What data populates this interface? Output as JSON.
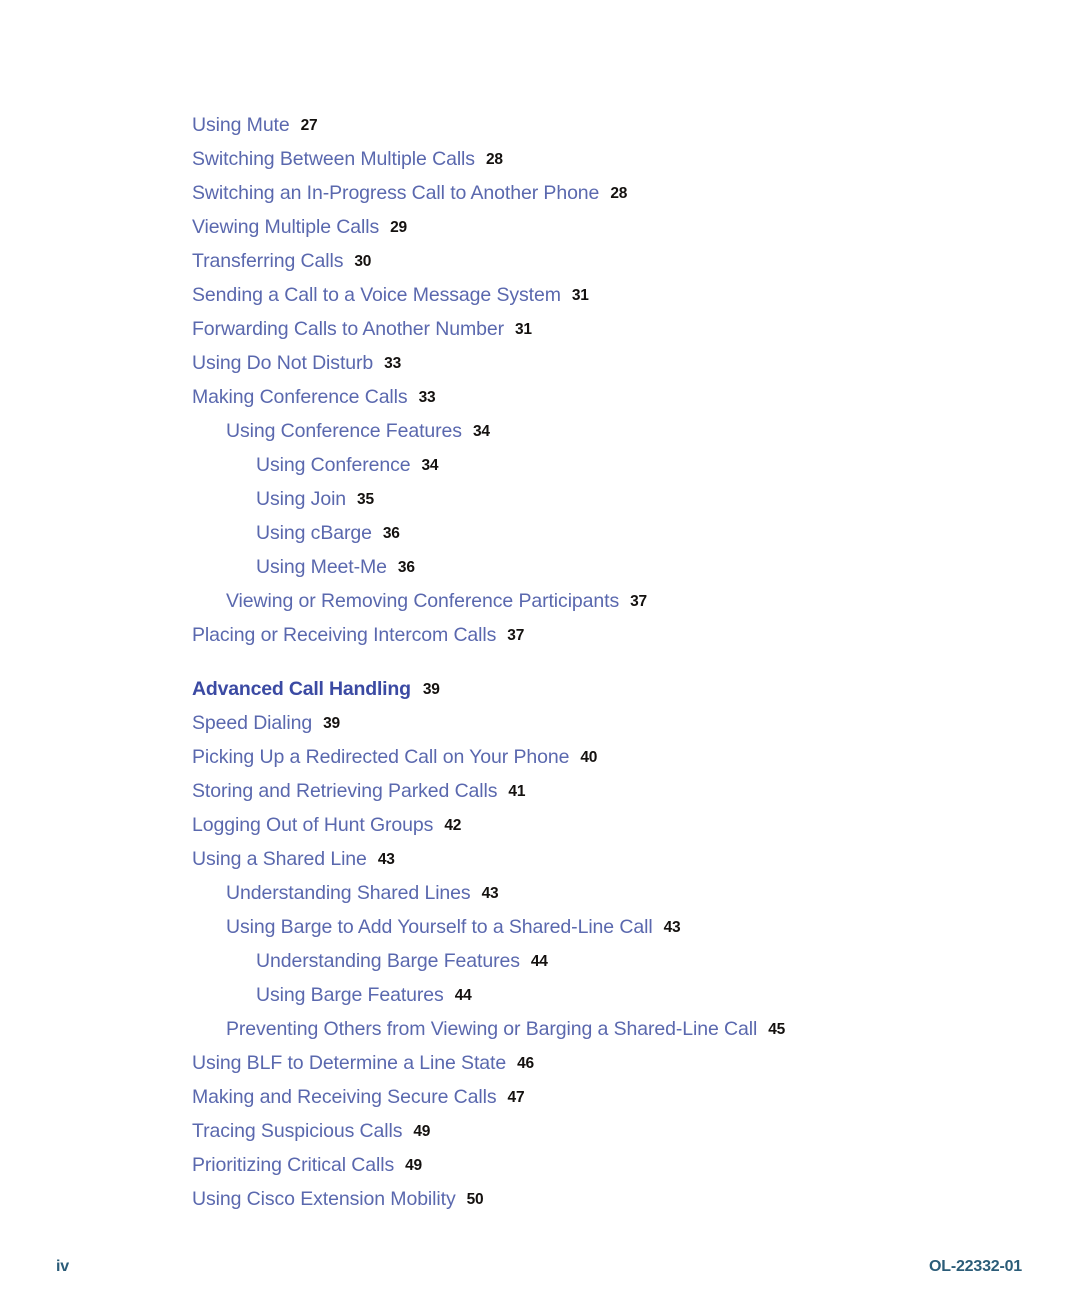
{
  "document": {
    "page_label": "iv",
    "doc_id": "OL-22332-01"
  },
  "colors": {
    "entry_text": "#5a68ae",
    "heading_text": "#3b4aa3",
    "page_number": "#14110f",
    "footer_text": "#2b5c78",
    "background": "#ffffff"
  },
  "toc": {
    "entries": [
      {
        "level": 1,
        "title": "Using Mute",
        "page": "27",
        "heading": false
      },
      {
        "level": 1,
        "title": "Switching Between Multiple Calls",
        "page": "28",
        "heading": false
      },
      {
        "level": 1,
        "title": "Switching an In-Progress Call to Another Phone",
        "page": "28",
        "heading": false
      },
      {
        "level": 1,
        "title": "Viewing Multiple Calls",
        "page": "29",
        "heading": false
      },
      {
        "level": 1,
        "title": "Transferring Calls",
        "page": "30",
        "heading": false
      },
      {
        "level": 1,
        "title": "Sending a Call to a Voice Message System",
        "page": "31",
        "heading": false
      },
      {
        "level": 1,
        "title": "Forwarding Calls to Another Number",
        "page": "31",
        "heading": false
      },
      {
        "level": 1,
        "title": "Using Do Not Disturb",
        "page": "33",
        "heading": false
      },
      {
        "level": 1,
        "title": "Making Conference Calls",
        "page": "33",
        "heading": false
      },
      {
        "level": 2,
        "title": "Using Conference Features",
        "page": "34",
        "heading": false
      },
      {
        "level": 3,
        "title": "Using Conference",
        "page": "34",
        "heading": false
      },
      {
        "level": 3,
        "title": "Using Join",
        "page": "35",
        "heading": false
      },
      {
        "level": 3,
        "title": "Using cBarge",
        "page": "36",
        "heading": false
      },
      {
        "level": 3,
        "title": "Using Meet-Me",
        "page": "36",
        "heading": false
      },
      {
        "level": 2,
        "title": "Viewing or Removing Conference Participants",
        "page": "37",
        "heading": false
      },
      {
        "level": 1,
        "title": "Placing or Receiving Intercom Calls",
        "page": "37",
        "heading": false
      },
      {
        "level": 1,
        "title": "Advanced Call Handling",
        "page": "39",
        "heading": true
      },
      {
        "level": 1,
        "title": "Speed Dialing",
        "page": "39",
        "heading": false
      },
      {
        "level": 1,
        "title": "Picking Up a Redirected Call on Your Phone",
        "page": "40",
        "heading": false
      },
      {
        "level": 1,
        "title": "Storing and Retrieving Parked Calls",
        "page": "41",
        "heading": false
      },
      {
        "level": 1,
        "title": "Logging Out of Hunt Groups",
        "page": "42",
        "heading": false
      },
      {
        "level": 1,
        "title": "Using a Shared Line",
        "page": "43",
        "heading": false
      },
      {
        "level": 2,
        "title": "Understanding Shared Lines",
        "page": "43",
        "heading": false
      },
      {
        "level": 2,
        "title": "Using Barge to Add Yourself to a Shared-Line Call",
        "page": "43",
        "heading": false
      },
      {
        "level": 3,
        "title": "Understanding Barge Features",
        "page": "44",
        "heading": false
      },
      {
        "level": 3,
        "title": "Using Barge Features",
        "page": "44",
        "heading": false
      },
      {
        "level": 2,
        "title": "Preventing Others from Viewing or Barging a Shared-Line Call",
        "page": "45",
        "heading": false
      },
      {
        "level": 1,
        "title": "Using BLF to Determine a Line State",
        "page": "46",
        "heading": false
      },
      {
        "level": 1,
        "title": "Making and Receiving Secure Calls",
        "page": "47",
        "heading": false
      },
      {
        "level": 1,
        "title": "Tracing Suspicious Calls",
        "page": "49",
        "heading": false
      },
      {
        "level": 1,
        "title": "Prioritizing Critical Calls",
        "page": "49",
        "heading": false
      },
      {
        "level": 1,
        "title": "Using Cisco Extension Mobility",
        "page": "50",
        "heading": false
      }
    ]
  }
}
